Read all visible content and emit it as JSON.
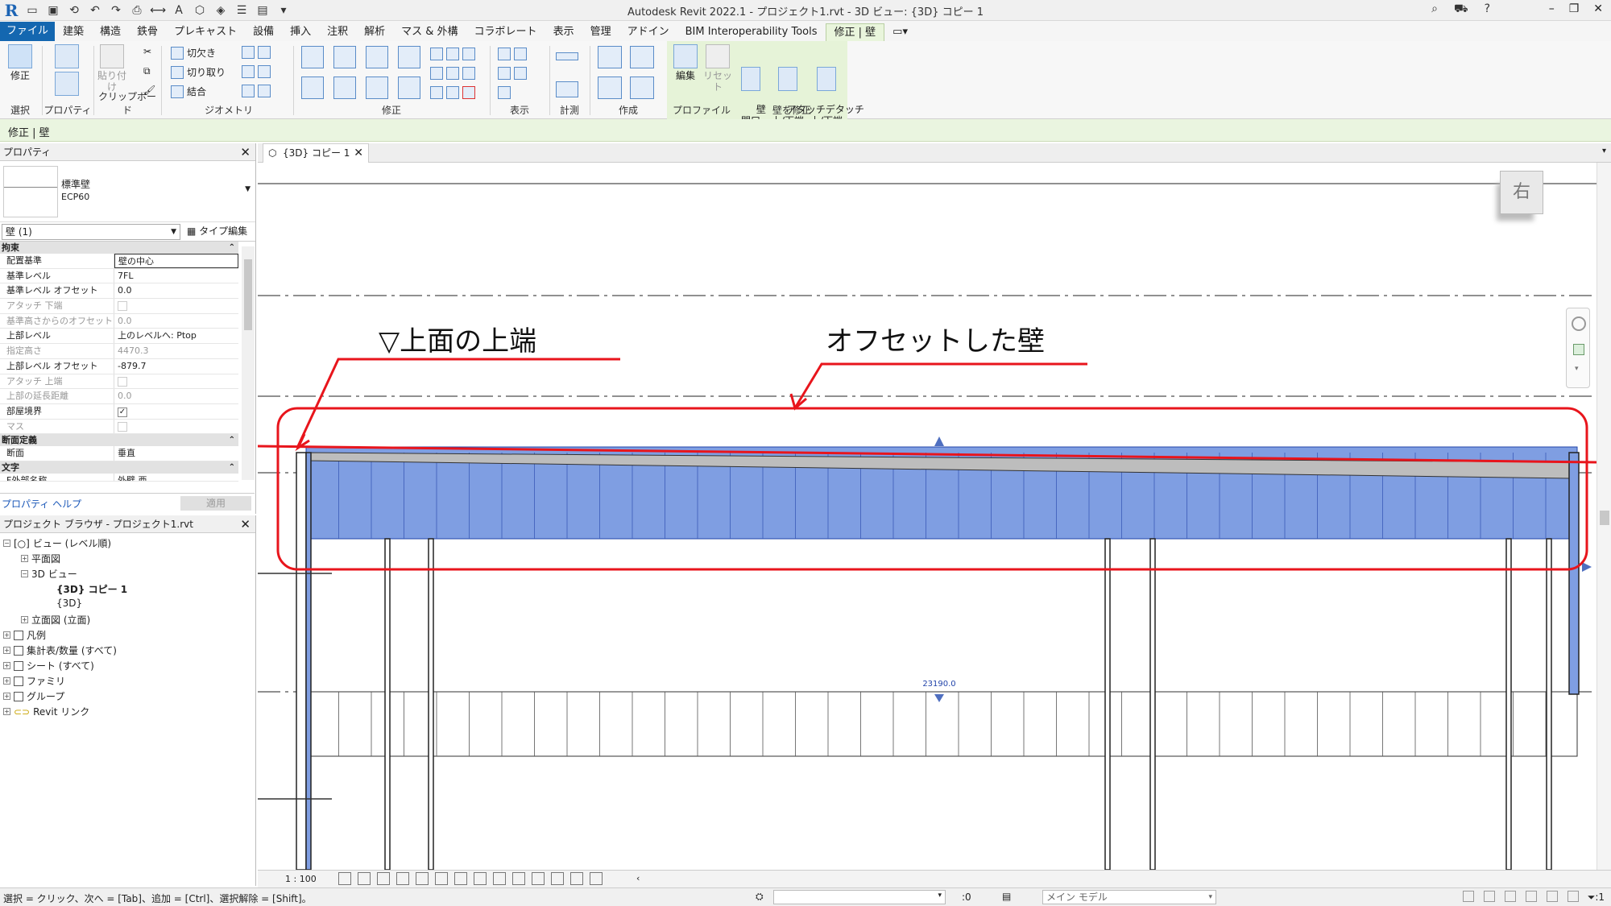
{
  "titlebar": {
    "title": "Autodesk Revit 2022.1 - プロジェクト1.rvt - 3D ビュー: {3D} コピー 1"
  },
  "tabs": [
    {
      "label": "ファイル"
    },
    {
      "label": "建築"
    },
    {
      "label": "構造"
    },
    {
      "label": "鉄骨"
    },
    {
      "label": "プレキャスト"
    },
    {
      "label": "設備"
    },
    {
      "label": "挿入"
    },
    {
      "label": "注釈"
    },
    {
      "label": "解析"
    },
    {
      "label": "マス & 外構"
    },
    {
      "label": "コラボレート"
    },
    {
      "label": "表示"
    },
    {
      "label": "管理"
    },
    {
      "label": "アドイン"
    },
    {
      "label": "BIM Interoperability Tools"
    },
    {
      "label": "修正 | 壁"
    }
  ],
  "ribbon": {
    "select_label": "選択",
    "modify_btn": "修正",
    "properties_label": "プロパティ",
    "paste_btn": "貼り付け",
    "clipboard_label": "クリップボード",
    "cope": "切欠き",
    "cut": "切り取り",
    "join": "結合",
    "geometry_label": "ジオメトリ",
    "modify_label": "修正",
    "view_label": "表示",
    "measure_label": "計測",
    "create_label": "作成",
    "edit_profile": "編集",
    "reset_profile": "リセット",
    "profile_label": "プロファイル",
    "wall_opening": "壁\n開口",
    "attach_topbase": "アタッチ\n上/下端",
    "detach_topbase": "デタッチ\n上/下端",
    "modify_wall_label": "壁を修正"
  },
  "context_bar": "修正 | 壁",
  "properties": {
    "header": "プロパティ",
    "type_name": "標準壁",
    "type_sub": "ECP60",
    "instance_select": "壁 (1)",
    "edit_type": "タイプ編集",
    "sections": {
      "constraints": "拘束",
      "structural": "断面定義",
      "text": "文字"
    },
    "rows": [
      {
        "k": "配置基準",
        "v": "壁の中心"
      },
      {
        "k": "基準レベル",
        "v": "7FL"
      },
      {
        "k": "基準レベル オフセット",
        "v": "0.0"
      },
      {
        "k": "アタッチ 下端",
        "v": ""
      },
      {
        "k": "基準高さからのオフセット",
        "v": "0.0"
      },
      {
        "k": "上部レベル",
        "v": "上のレベルへ: Ptop"
      },
      {
        "k": "指定高さ",
        "v": "4470.3"
      },
      {
        "k": "上部レベル オフセット",
        "v": "-879.7"
      },
      {
        "k": "アタッチ 上端",
        "v": ""
      },
      {
        "k": "上部の延長距離",
        "v": "0.0"
      },
      {
        "k": "部屋境界",
        "v": ""
      },
      {
        "k": "マス",
        "v": ""
      }
    ],
    "struct_row": {
      "k": "断面",
      "v": "垂直"
    },
    "text_row": {
      "k": "F外部名称",
      "v": "外壁 西"
    },
    "help_link": "プロパティ ヘルプ",
    "apply_btn": "適用"
  },
  "browser": {
    "header": "プロジェクト ブラウザ - プロジェクト1.rvt",
    "nodes": [
      {
        "label": "ビュー (レベル順)"
      },
      {
        "label": "平面図"
      },
      {
        "label": "3D ビュー"
      },
      {
        "label": "{3D} コピー 1"
      },
      {
        "label": "{3D}"
      },
      {
        "label": "立面図 (立面)"
      },
      {
        "label": "凡例"
      },
      {
        "label": "集計表/数量 (すべて)"
      },
      {
        "label": "シート (すべて)"
      },
      {
        "label": "ファミリ"
      },
      {
        "label": "グループ"
      },
      {
        "label": "Revit リンク"
      }
    ]
  },
  "view": {
    "tab_label": "{3D} コピー 1",
    "viewcube_face": "右",
    "dimension": "23190.0",
    "scale": "1 : 100"
  },
  "annotations": {
    "top_edge": "▽上面の上端",
    "offset_wall": "オフセットした壁"
  },
  "status": {
    "message": "選択 = クリック、次へ = [Tab]、追加 = [Ctrl]、選択解除 = [Shift]。",
    "zero": ":0",
    "model": "メイン モデル",
    "filter_count": ":1"
  },
  "colors": {
    "wall_fill": "#7f9ee2",
    "highlight": "#e8151c",
    "accent": "#1467b0",
    "context_tab": "#e6f3d8"
  }
}
